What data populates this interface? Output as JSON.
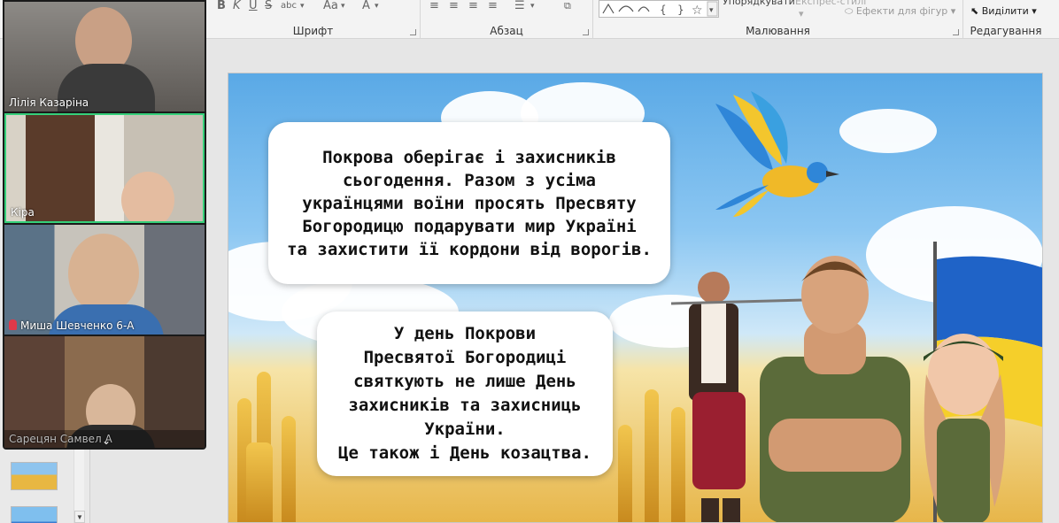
{
  "ribbon": {
    "groups": [
      {
        "label": "Шрифт"
      },
      {
        "label": "Абзац"
      },
      {
        "label": "Малювання"
      },
      {
        "label": "Редагування"
      }
    ],
    "arrange_label": "Упорядкувати",
    "quick_styles_label": "Експрес-стилі",
    "shape_effects_label": "Ефекти для фігур",
    "select_label": "Виділити"
  },
  "participants": [
    {
      "name": "Лілія Казаріна",
      "muted": false,
      "active": false
    },
    {
      "name": "Кіра",
      "muted": false,
      "active": true
    },
    {
      "name": "Миша Шевченко 6-А",
      "muted": true,
      "active": false
    },
    {
      "name": "Сарецян Самвел А",
      "muted": false,
      "active": false
    }
  ],
  "slide": {
    "text_1": "Покрова оберігає і захисників\nсьогодення. Разом з усіма\nукраїнцями воїни просять Пресвяту\nБогородицю подарувати мир Україні\nта захистити її кордони від ворогів.",
    "text_2": "У день Покрови\nПресвятої Богородиці\nсвяткують не лише День\nзахисників та захисниць\nУкраїни.\nЦе також і День козацтва."
  },
  "colors": {
    "active_speaker_border": "#35d07a",
    "muted_icon": "#e0394a",
    "flag_blue": "#1f63c7",
    "flag_yellow": "#f5cf2a"
  },
  "icons": [
    "bold-icon",
    "italic-icon",
    "underline-icon",
    "strikethrough-icon",
    "font-color-icon",
    "align-left-icon",
    "align-center-icon",
    "align-right-icon",
    "justify-icon",
    "columns-icon",
    "shapes-gallery-icon",
    "select-icon",
    "chevron-down-icon",
    "microphone-muted-icon"
  ]
}
